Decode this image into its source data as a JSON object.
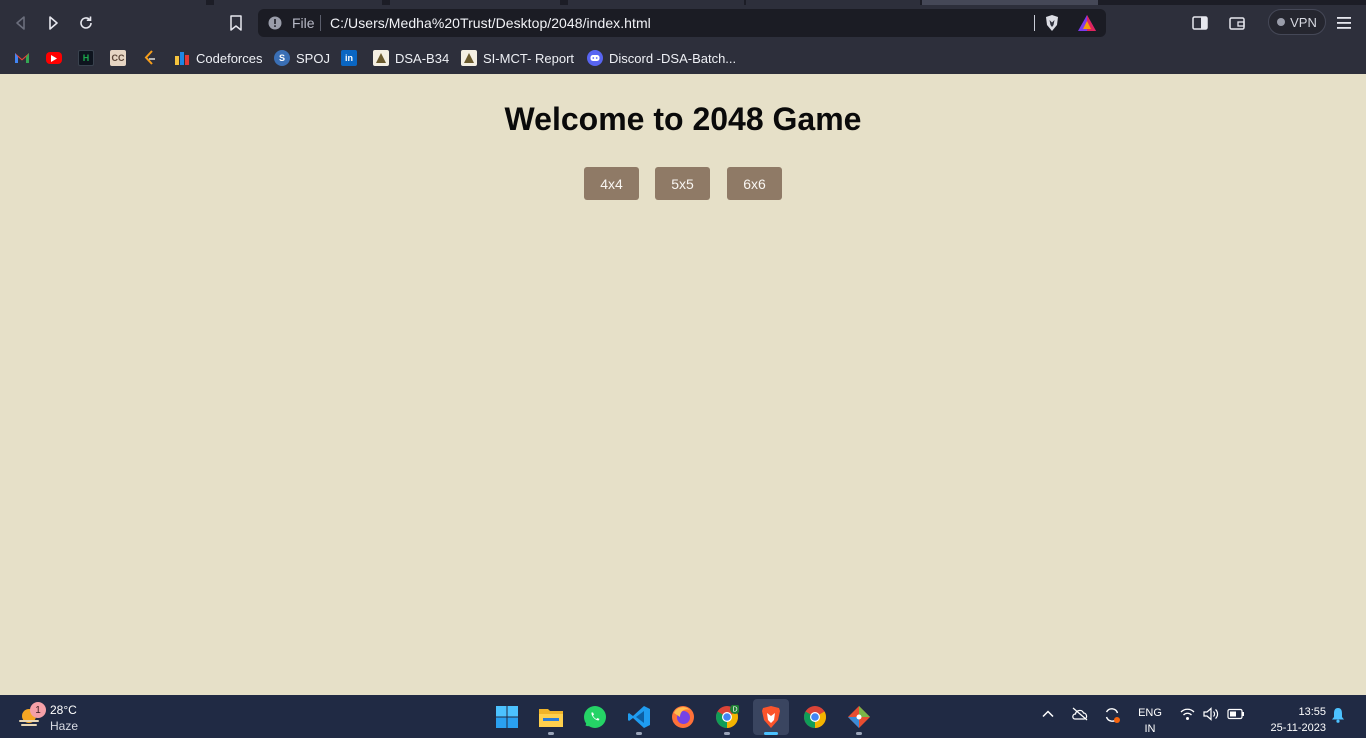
{
  "browser": {
    "address": {
      "scheme_label": "File",
      "url": "C:/Users/Medha%20Trust/Desktop/2048/index.html"
    },
    "vpn_label": "VPN",
    "bookmarks": [
      {
        "label": "",
        "icon": "gmail-icon"
      },
      {
        "label": "",
        "icon": "youtube-icon"
      },
      {
        "label": "",
        "icon": "hackerrank-icon"
      },
      {
        "label": "",
        "icon": "codechef-icon"
      },
      {
        "label": "",
        "icon": "leetcode-icon"
      },
      {
        "label": "Codeforces",
        "icon": "codeforces-icon"
      },
      {
        "label": "SPOJ",
        "icon": "spoj-icon"
      },
      {
        "label": "",
        "icon": "linkedin-icon"
      },
      {
        "label": "DSA-B34",
        "icon": "college-icon"
      },
      {
        "label": "SI-MCT- Report",
        "icon": "college-icon"
      },
      {
        "label": "Discord -DSA-Batch...",
        "icon": "discord-icon"
      }
    ]
  },
  "page": {
    "title": "Welcome to 2048 Game",
    "size_options": [
      "4x4",
      "5x5",
      "6x6"
    ]
  },
  "taskbar": {
    "weather": {
      "temp": "28°C",
      "condition": "Haze",
      "badge": "1"
    },
    "apps": [
      "start",
      "file-explorer",
      "whatsapp",
      "vscode",
      "firefox",
      "chrome-profile",
      "brave",
      "chrome",
      "git-gui"
    ],
    "language": {
      "line1": "ENG",
      "line2": "IN"
    },
    "clock": {
      "time": "13:55",
      "date": "25-11-2023"
    }
  },
  "colors": {
    "page_background": "#e6e0c8",
    "button_background": "#8f7a66",
    "button_text": "#f9f6f2",
    "browser_chrome": "#2d2f3b",
    "taskbar": "#202a44"
  }
}
